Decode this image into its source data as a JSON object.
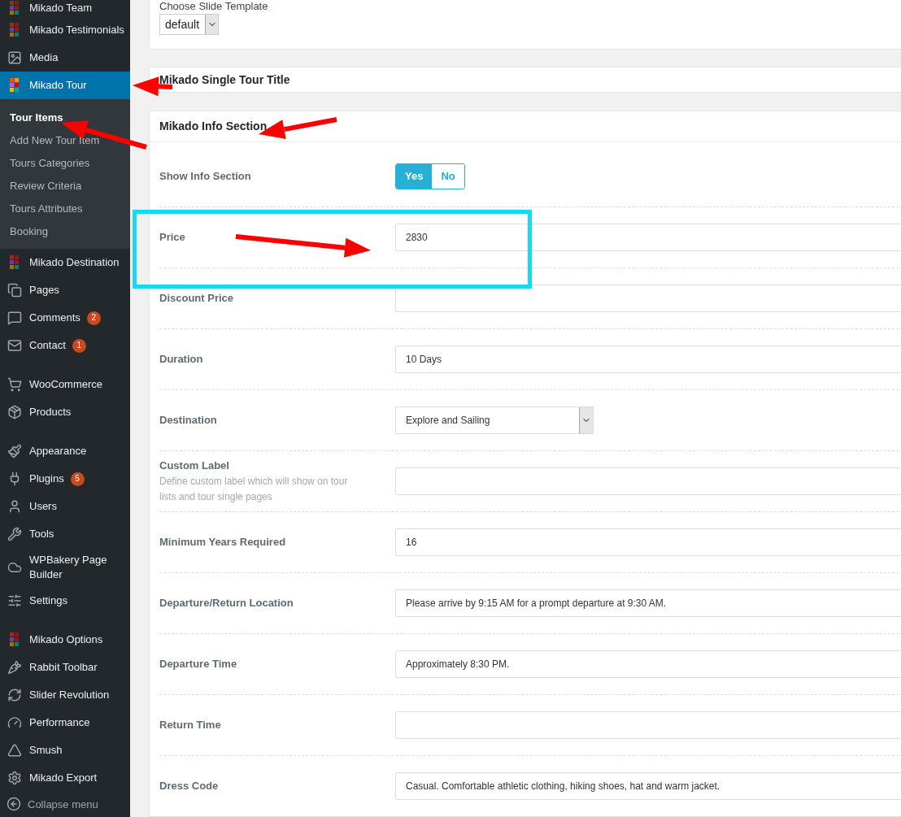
{
  "sidebar": {
    "items": [
      {
        "label": "Mikado Team",
        "selected": false
      },
      {
        "label": "Mikado Testimonials",
        "selected": false
      },
      {
        "label": "Media",
        "selected": false
      },
      {
        "label": "Mikado Tour",
        "selected": true,
        "children": [
          {
            "label": "Tour Items",
            "selected": true
          },
          {
            "label": "Add New Tour Item",
            "selected": false
          },
          {
            "label": "Tours Categories",
            "selected": false
          },
          {
            "label": "Review Criteria",
            "selected": false
          },
          {
            "label": "Tours Attributes",
            "selected": false
          },
          {
            "label": "Booking",
            "selected": false
          }
        ]
      },
      {
        "label": "Mikado Destination",
        "selected": false
      },
      {
        "label": "Pages",
        "selected": false
      },
      {
        "label": "Comments",
        "selected": false,
        "badge": "2"
      },
      {
        "label": "Contact",
        "selected": false,
        "badge": "1"
      },
      {
        "label": "WooCommerce",
        "selected": false
      },
      {
        "label": "Products",
        "selected": false
      },
      {
        "label": "Appearance",
        "selected": false
      },
      {
        "label": "Plugins",
        "selected": false,
        "badge": "5"
      },
      {
        "label": "Users",
        "selected": false
      },
      {
        "label": "Tools",
        "selected": false
      },
      {
        "label": "WPBakery Page Builder",
        "selected": false
      },
      {
        "label": "Settings",
        "selected": false
      },
      {
        "label": "Mikado Options",
        "selected": false
      },
      {
        "label": "Rabbit Toolbar",
        "selected": false
      },
      {
        "label": "Slider Revolution",
        "selected": false
      },
      {
        "label": "Performance",
        "selected": false
      },
      {
        "label": "Smush",
        "selected": false
      },
      {
        "label": "Mikado Export",
        "selected": false
      }
    ],
    "collapse": "Collapse menu"
  },
  "slide_template": {
    "label": "Choose Slide Template",
    "value": "default"
  },
  "single_tour_title": {
    "title": "Mikado Single Tour Title"
  },
  "info_section": {
    "title": "Mikado Info Section",
    "fields": [
      {
        "kind": "toggle",
        "label": "Show Info Section",
        "options": [
          {
            "label": "Yes",
            "selected": true
          },
          {
            "label": "No",
            "selected": false
          }
        ]
      },
      {
        "kind": "text",
        "label": "Price",
        "value": "2830"
      },
      {
        "kind": "text",
        "label": "Discount Price"
      },
      {
        "kind": "text",
        "label": "Duration",
        "value": "10 Days"
      },
      {
        "kind": "select",
        "label": "Destination",
        "value": "Explore and Sailing"
      },
      {
        "kind": "text",
        "label": "Custom Label",
        "description": "Define custom label which will show on tour lists and tour single pages"
      },
      {
        "kind": "text",
        "label": "Minimum Years Required",
        "value": "16"
      },
      {
        "kind": "text",
        "label": "Departure/Return Location",
        "value": "Please arrive by 9:15 AM for a prompt departure at 9:30 AM."
      },
      {
        "kind": "text",
        "label": "Departure Time",
        "value": "Approximately 8:30 PM."
      },
      {
        "kind": "text",
        "label": "Return Time"
      },
      {
        "kind": "text",
        "label": "Dress Code",
        "value": "Casual. Comfortable athletic clothing, hiking shoes, hat and warm jacket."
      }
    ]
  }
}
